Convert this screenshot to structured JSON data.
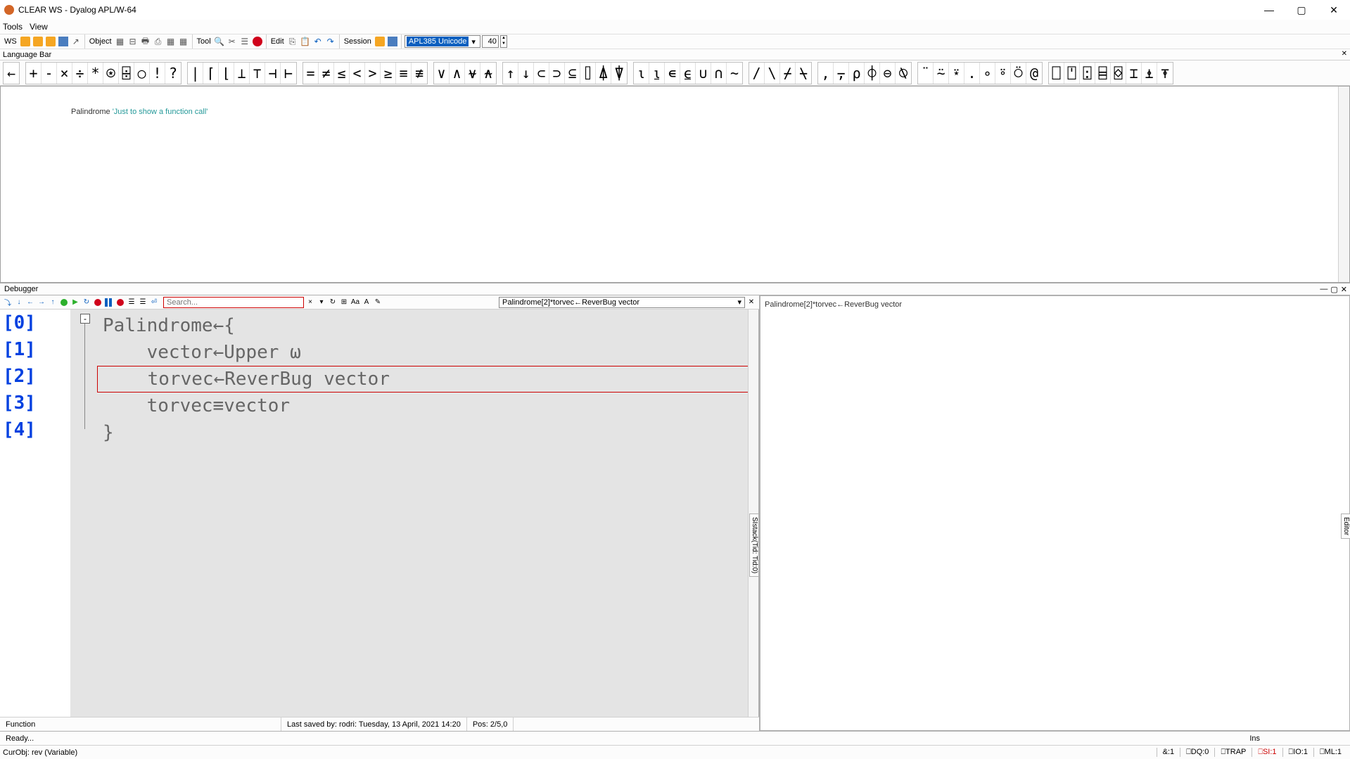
{
  "window": {
    "title": "CLEAR WS - Dyalog APL/W-64"
  },
  "menu": {
    "tools": "Tools",
    "view": "View"
  },
  "toolbar": {
    "ws": "WS",
    "object": "Object",
    "tool": "Tool",
    "edit": "Edit",
    "session": "Session",
    "fontname": "APL385 Unicode",
    "fontsize": "40"
  },
  "langbar": {
    "label": "Language Bar"
  },
  "session_line": {
    "fn": "Palindrome ",
    "str": "'Just to show a function call'"
  },
  "debugger": {
    "title": "Debugger",
    "search_placeholder": "Search...",
    "crumb": "Palindrome[2]*torvec←ReverBug vector",
    "lines": [
      "[0]",
      "[1]",
      "[2]",
      "[3]",
      "[4]"
    ],
    "code": [
      "Palindrome←{",
      "    vector←Upper ⍵",
      "    torvec←ReverBug vector",
      "    torvec≡vector",
      "}"
    ],
    "status_fn": "Function",
    "status_saved": "Last saved by: rodri: Tuesday, 13 April, 2021 14:20",
    "status_pos": "Pos: 2/5,0"
  },
  "stack": {
    "line": "Palindrome[2]*torvec←ReverBug vector"
  },
  "sidetabs": {
    "stack": "SIstack(Tid: Tid:0)",
    "editor": "Editor"
  },
  "status1": {
    "ready": "Ready...",
    "ins": "Ins"
  },
  "status2": {
    "curobj": "CurObj: rev (Variable)",
    "amp": "&:1",
    "dq": "⎕DQ:0",
    "trap": "⎕TRAP",
    "si": "⎕SI:1",
    "io": "⎕IO:1",
    "ml": "⎕ML:1"
  }
}
